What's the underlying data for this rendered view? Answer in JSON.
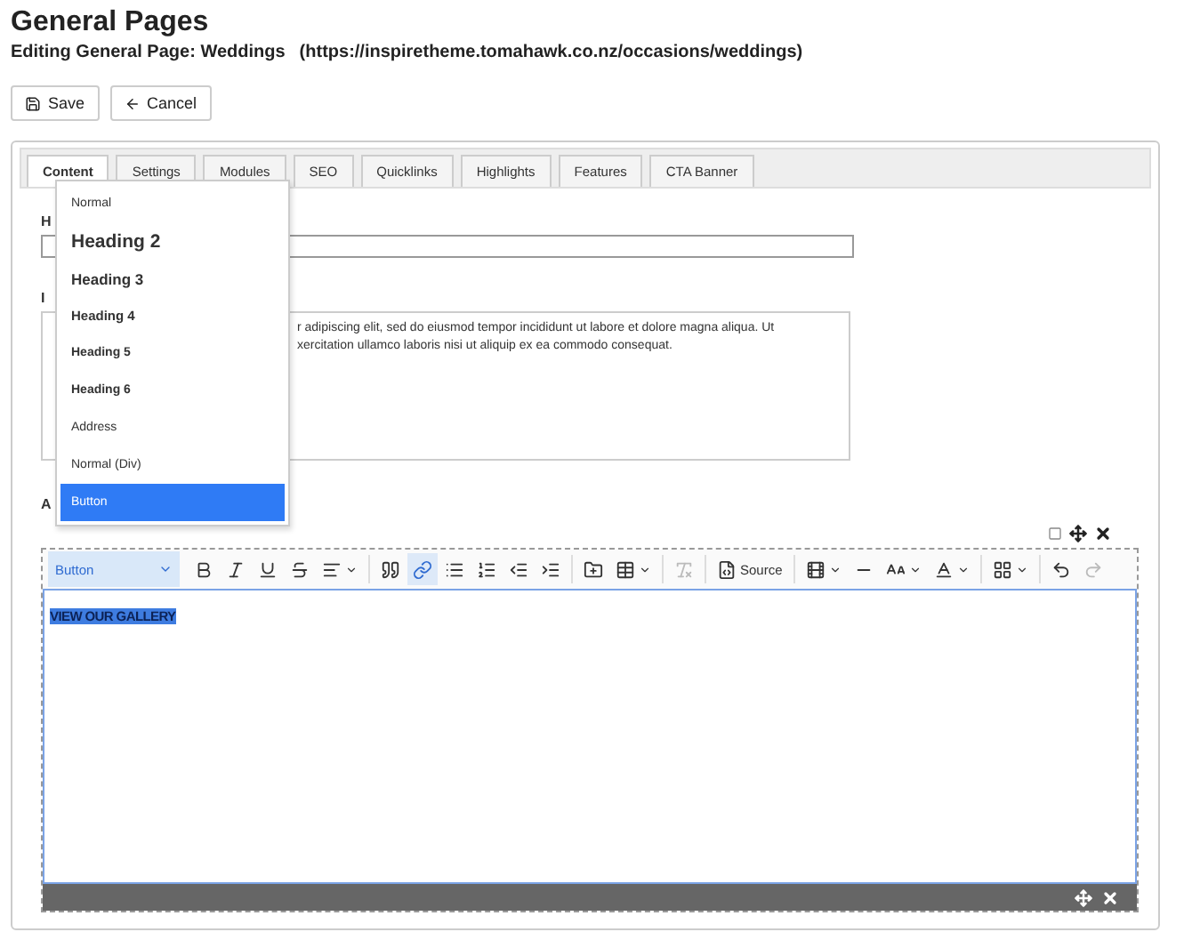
{
  "page": {
    "title": "General Pages",
    "subtitle": "Editing General Page: Weddings",
    "url": "(https://inspiretheme.tomahawk.co.nz/occasions/weddings)"
  },
  "buttons": [
    {
      "label": "Save",
      "kind": "save"
    },
    {
      "label": "Cancel",
      "kind": "cancel"
    }
  ],
  "tabs": [
    {
      "label": "Content",
      "selected": true
    },
    {
      "label": "Settings",
      "selected": false
    },
    {
      "label": "Modules",
      "selected": false
    },
    {
      "label": "SEO",
      "selected": false
    },
    {
      "label": "Quicklinks",
      "selected": false
    },
    {
      "label": "Highlights",
      "selected": false
    },
    {
      "label": "Features",
      "selected": false
    },
    {
      "label": "CTA Banner",
      "selected": false
    }
  ],
  "fields": [
    {
      "label": "H",
      "kind": "input"
    },
    {
      "label": "I",
      "kind": "textarea",
      "lines": [
        "r adipiscing elit, sed do eiusmod tempor incididunt ut labore et dolore magna aliqua. Ut",
        "xercitation ullamco laboris nisi ut aliquip ex ea commodo consequat."
      ]
    },
    {
      "label": "A",
      "kind": "label"
    }
  ],
  "format_menu": [
    {
      "label": "Normal",
      "kind": "p",
      "selected": false
    },
    {
      "label": "Heading 2",
      "kind": "h2",
      "selected": false
    },
    {
      "label": "Heading 3",
      "kind": "h3",
      "selected": false
    },
    {
      "label": "Heading 4",
      "kind": "h4",
      "selected": false
    },
    {
      "label": "Heading 5",
      "kind": "h5",
      "selected": false
    },
    {
      "label": "Heading 6",
      "kind": "h6",
      "selected": false
    },
    {
      "label": "Address",
      "kind": "p",
      "selected": false
    },
    {
      "label": "Normal (Div)",
      "kind": "p",
      "selected": false
    },
    {
      "label": "Button",
      "kind": "p",
      "selected": true
    }
  ],
  "editor": {
    "format_select": "Button",
    "source_label": "Source",
    "content": "VIEW OUR GALLERY",
    "toolbar": [
      {
        "kind": "bold",
        "active": false,
        "disabled": false
      },
      {
        "kind": "italic",
        "active": false,
        "disabled": false
      },
      {
        "kind": "underline",
        "active": false,
        "disabled": false
      },
      {
        "kind": "strike",
        "active": false,
        "disabled": false
      },
      {
        "kind": "align",
        "active": false,
        "disabled": false
      },
      {
        "kind": "sep"
      },
      {
        "kind": "quote",
        "active": false,
        "disabled": false
      },
      {
        "kind": "link",
        "active": true,
        "disabled": false
      },
      {
        "kind": "bullets",
        "active": false,
        "disabled": false
      },
      {
        "kind": "numbers",
        "active": false,
        "disabled": false
      },
      {
        "kind": "outdent",
        "active": false,
        "disabled": false
      },
      {
        "kind": "indent",
        "active": false,
        "disabled": false
      },
      {
        "kind": "sep"
      },
      {
        "kind": "image",
        "active": false,
        "disabled": false
      },
      {
        "kind": "table",
        "active": false,
        "disabled": false
      },
      {
        "kind": "sep"
      },
      {
        "kind": "clear",
        "active": false,
        "disabled": true
      },
      {
        "kind": "sep"
      },
      {
        "kind": "source",
        "active": false,
        "disabled": false
      },
      {
        "kind": "sep"
      },
      {
        "kind": "media",
        "active": false,
        "disabled": false
      },
      {
        "kind": "rule",
        "active": false,
        "disabled": false
      },
      {
        "kind": "size",
        "active": false,
        "disabled": false
      },
      {
        "kind": "color",
        "active": false,
        "disabled": false
      },
      {
        "kind": "sep"
      },
      {
        "kind": "layout",
        "active": false,
        "disabled": false
      },
      {
        "kind": "sep"
      },
      {
        "kind": "undo",
        "active": false,
        "disabled": false
      },
      {
        "kind": "redo",
        "active": false,
        "disabled": true
      }
    ]
  }
}
